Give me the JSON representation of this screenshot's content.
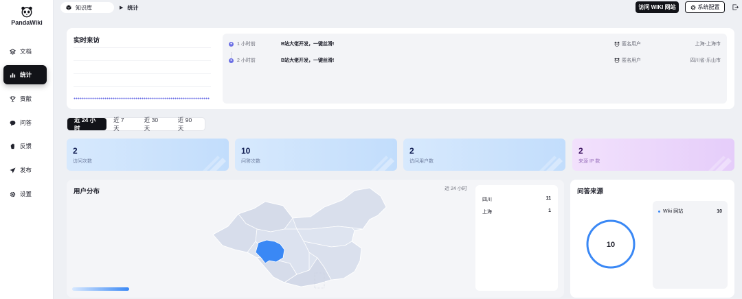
{
  "app": {
    "name": "PandaWiki"
  },
  "sidebar": {
    "items": [
      {
        "label": "文档",
        "icon": "layers-icon",
        "active": false
      },
      {
        "label": "统计",
        "icon": "bar-chart-icon",
        "active": true
      },
      {
        "label": "贡献",
        "icon": "trophy-icon",
        "active": false
      },
      {
        "label": "问答",
        "icon": "chat-bubble-icon",
        "active": false
      },
      {
        "label": "反馈",
        "icon": "hand-icon",
        "active": false
      },
      {
        "label": "发布",
        "icon": "send-icon",
        "active": false
      },
      {
        "label": "设置",
        "icon": "gear-icon",
        "active": false
      }
    ]
  },
  "header": {
    "breadcrumb_root": "知识库",
    "breadcrumb_current": "统计",
    "visit_button": "访问 WIKI 网站",
    "config_button": "系统配置"
  },
  "realtime": {
    "title": "实时来访",
    "visits": [
      {
        "time": "1 小时前",
        "title": "B站大佬开发，一键丝滑!",
        "user": "匿名用户",
        "location": "上海-上海市"
      },
      {
        "time": "2 小时前",
        "title": "B站大佬开发，一键丝滑!",
        "user": "匿名用户",
        "location": "四川省-乐山市"
      }
    ]
  },
  "tabs": [
    {
      "label": "近 24 小时",
      "active": true
    },
    {
      "label": "近 7 天",
      "active": false
    },
    {
      "label": "近 30 天",
      "active": false
    },
    {
      "label": "近 90 天",
      "active": false
    }
  ],
  "stats": [
    {
      "value": "2",
      "label": "访问次数",
      "tone": "blue"
    },
    {
      "value": "10",
      "label": "问答次数",
      "tone": "blue"
    },
    {
      "value": "2",
      "label": "访问用户数",
      "tone": "blue"
    },
    {
      "value": "2",
      "label": "来源 IP 数",
      "tone": "purple"
    }
  ],
  "distribution": {
    "title": "用户分布",
    "range": "近 24 小时",
    "regions": [
      {
        "name": "四川",
        "value": "11"
      },
      {
        "name": "上海",
        "value": "1"
      }
    ],
    "highlight_color": "#3a88f5"
  },
  "qa_source": {
    "title": "问答来源",
    "total": "10",
    "items": [
      {
        "name": "Wiki 网站",
        "value": "10"
      }
    ],
    "ring_color": "#3a88f5"
  },
  "colors": {
    "dark": "#121318",
    "accent": "#3a88f5",
    "dot": "#6b6fe4"
  }
}
